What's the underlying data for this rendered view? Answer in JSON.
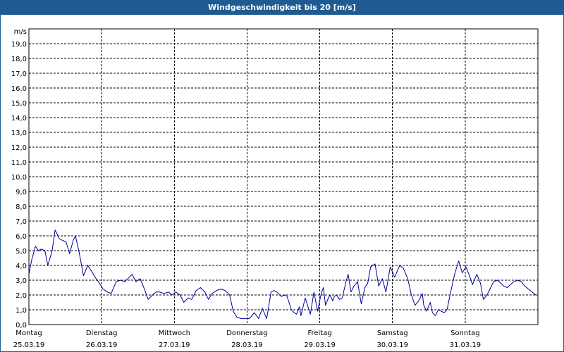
{
  "window": {
    "title": "Windgeschwindigkeit bis 20 [m/s]"
  },
  "colors": {
    "title_bar": "#1f5b92",
    "line": "#000099",
    "grid": "#000000"
  },
  "chart_data": {
    "type": "line",
    "title": "Windgeschwindigkeit bis 20 [m/s]",
    "ylabel": "m/s",
    "xlabel": "",
    "ylim": [
      0,
      20
    ],
    "xlim": [
      0,
      7
    ],
    "y_ticks": [
      "0,0",
      "1,0",
      "2,0",
      "3,0",
      "4,0",
      "5,0",
      "6,0",
      "7,0",
      "8,0",
      "9,0",
      "10,0",
      "11,0",
      "12,0",
      "13,0",
      "14,0",
      "15,0",
      "16,0",
      "17,0",
      "18,0",
      "19,0"
    ],
    "x_ticks": [
      {
        "day": "Montag",
        "date": "25.03.19"
      },
      {
        "day": "Dienstag",
        "date": "26.03.19"
      },
      {
        "day": "Mittwoch",
        "date": "27.03.19"
      },
      {
        "day": "Donnerstag",
        "date": "28.03.19"
      },
      {
        "day": "Freitag",
        "date": "29.03.19"
      },
      {
        "day": "Samstag",
        "date": "30.03.19"
      },
      {
        "day": "Sonntag",
        "date": "31.03.19"
      }
    ],
    "grid": true,
    "series": [
      {
        "x": [
          0,
          0.04,
          0.09,
          0.13,
          0.17,
          0.22,
          0.26,
          0.32,
          0.36,
          0.42,
          0.46,
          0.51,
          0.56,
          0.61,
          0.64,
          0.69,
          0.75,
          0.81,
          0.85,
          0.91,
          0.97,
          1.02,
          1.08,
          1.13,
          1.2,
          1.26,
          1.32,
          1.38,
          1.42,
          1.47,
          1.53,
          1.58,
          1.64,
          1.7,
          1.75,
          1.8,
          1.86,
          1.92,
          1.97,
          2.02,
          2.08,
          2.13,
          2.19,
          2.24,
          2.3,
          2.36,
          2.42,
          2.47,
          2.52,
          2.58,
          2.64,
          2.7,
          2.76,
          2.81,
          2.86,
          2.92,
          2.98,
          3.03,
          3.05,
          3.1,
          3.16,
          3.21,
          3.27,
          3.33,
          3.37,
          3.41,
          3.47,
          3.52,
          3.55,
          3.61,
          3.65,
          3.68,
          3.72,
          3.74,
          3.8,
          3.87,
          3.92,
          3.97,
          4.02,
          4.05,
          4.08,
          4.11,
          4.14,
          4.18,
          4.2,
          4.23,
          4.27,
          4.31,
          4.36,
          4.39,
          4.43,
          4.47,
          4.52,
          4.57,
          4.62,
          4.66,
          4.7,
          4.76,
          4.81,
          4.86,
          4.91,
          4.97,
          5.03,
          5.1,
          5.15,
          5.21,
          5.26,
          5.31,
          5.36,
          5.41,
          5.43,
          5.47,
          5.52,
          5.55,
          5.59,
          5.63,
          5.67,
          5.71,
          5.75,
          5.8,
          5.86,
          5.91,
          5.96,
          6.01,
          6.06,
          6.1,
          6.16,
          6.21,
          6.25,
          6.3,
          6.34,
          6.39,
          6.44,
          6.49,
          6.53,
          6.58,
          6.62,
          6.67,
          6.72,
          6.77,
          6.82,
          6.87,
          6.92,
          6.97,
          7.0
        ],
        "y": [
          3.4,
          4.4,
          5.3,
          5.0,
          5.1,
          5.0,
          4.0,
          5.0,
          6.4,
          5.8,
          5.7,
          5.6,
          4.8,
          5.7,
          6.0,
          4.9,
          3.3,
          4.0,
          3.7,
          3.2,
          2.8,
          2.4,
          2.2,
          2.1,
          2.9,
          3.0,
          2.9,
          3.2,
          3.4,
          2.9,
          3.1,
          2.5,
          1.7,
          2.0,
          2.2,
          2.2,
          2.1,
          2.2,
          2.0,
          2.2,
          2.0,
          1.5,
          1.8,
          1.7,
          2.3,
          2.5,
          2.2,
          1.7,
          2.1,
          2.3,
          2.4,
          2.3,
          2.0,
          0.9,
          0.5,
          0.4,
          0.4,
          0.4,
          0.5,
          0.8,
          0.4,
          1.1,
          0.4,
          2.2,
          2.3,
          2.2,
          1.9,
          2.0,
          1.9,
          1.0,
          0.8,
          0.7,
          1.2,
          0.6,
          1.8,
          0.7,
          2.2,
          0.9,
          2.1,
          2.5,
          1.3,
          1.7,
          2.0,
          1.6,
          1.9,
          2.0,
          1.7,
          1.8,
          2.9,
          3.4,
          2.2,
          2.6,
          2.9,
          1.4,
          2.5,
          2.8,
          3.9,
          4.1,
          2.6,
          3.1,
          2.2,
          3.9,
          3.2,
          4.0,
          3.8,
          3.1,
          2.0,
          1.3,
          1.6,
          2.1,
          1.3,
          0.9,
          1.5,
          0.8,
          0.6,
          1.0,
          0.9,
          0.8,
          1.0,
          2.2,
          3.5,
          4.3,
          3.5,
          3.9,
          3.3,
          2.7,
          3.4,
          2.8,
          1.7,
          2.0,
          2.4,
          2.9,
          3.0,
          2.8,
          2.6,
          2.5,
          2.7,
          2.9,
          3.0,
          2.9,
          2.6,
          2.4,
          2.2,
          2.0,
          2.0
        ]
      }
    ]
  }
}
